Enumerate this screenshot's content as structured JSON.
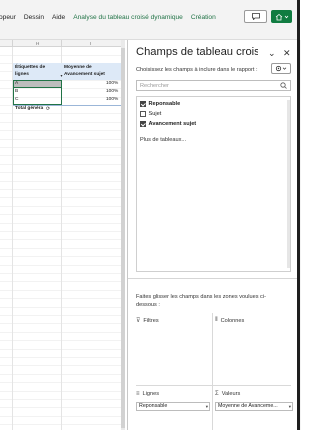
{
  "ribbon": {
    "tabs": [
      "opeur",
      "Dessin",
      "Aide",
      "Analyse du tableau croisé dynamique",
      "Création"
    ],
    "comment_icon": "comment-icon",
    "share_icon": "share-icon"
  },
  "sheet": {
    "col_headers": [
      "H",
      "I"
    ],
    "pivot": {
      "row_label_header": "Étiquettes de lignes",
      "value_header": "Moyenne de Avancement sujet",
      "rows": [
        {
          "label": "A",
          "value": "100%"
        },
        {
          "label": "B",
          "value": "100%"
        },
        {
          "label": "C",
          "value": "100%"
        }
      ],
      "total_label": "Total généra"
    }
  },
  "pane": {
    "title": "Champs de tableau crois...",
    "choose_text": "Choisissez les champs à inclure dans le rapport :",
    "search_placeholder": "Rechercher",
    "fields": [
      {
        "label": "Reponsable",
        "checked": true
      },
      {
        "label": "Sujet",
        "checked": false
      },
      {
        "label": "Avancement sujet",
        "checked": true
      }
    ],
    "more_tables": "Plus de tableaux...",
    "drag_text": "Faites glisser les champs dans les zones voulues ci-dessous :",
    "zones": {
      "filters": "Filtres",
      "columns": "Colonnes",
      "rows": "Lignes",
      "values": "Valeurs"
    },
    "rows_chip": "Reponsable",
    "values_chip": "Moyenne de Avanceme..."
  },
  "colors": {
    "accent_green": "#217346",
    "share_green": "#107c41",
    "pivot_header_blue": "#dde9f7"
  }
}
